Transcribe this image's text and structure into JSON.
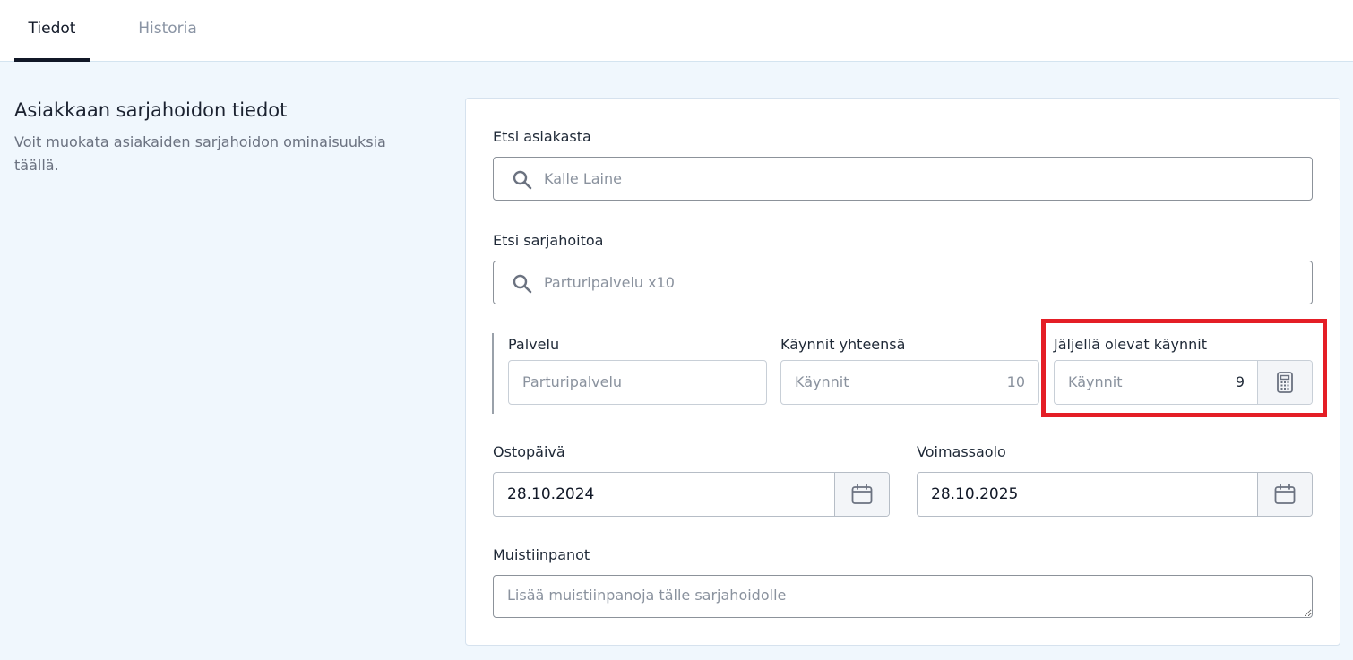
{
  "tabs": [
    {
      "label": "Tiedot",
      "active": true
    },
    {
      "label": "Historia",
      "active": false
    }
  ],
  "section": {
    "title": "Asiakkaan sarjahoidon tiedot",
    "description": "Voit muokata asiakaiden sarjahoidon ominaisuuksia täällä."
  },
  "form": {
    "customer_search": {
      "label": "Etsi asiakasta",
      "placeholder": "Kalle Laine"
    },
    "package_search": {
      "label": "Etsi sarjahoitoa",
      "placeholder": "Parturipalvelu x10"
    },
    "service": {
      "label": "Palvelu",
      "placeholder": "Parturipalvelu"
    },
    "total_visits": {
      "label": "Käynnit yhteensä",
      "placeholder": "Käynnit",
      "value": "10"
    },
    "remaining_visits": {
      "label": "Jäljellä olevat käynnit",
      "placeholder": "Käynnit",
      "value": "9"
    },
    "purchase_date": {
      "label": "Ostopäivä",
      "value": "28.10.2024"
    },
    "validity": {
      "label": "Voimassaolo",
      "value": "28.10.2025"
    },
    "notes": {
      "label": "Muistiinpanot",
      "placeholder": "Lisää muistiinpanoja tälle sarjahoidolle"
    }
  },
  "colors": {
    "highlight": "#e41e26",
    "page_background": "#f0f7fd",
    "active_tab": "#111827"
  },
  "icons": {
    "search": "search-icon",
    "calculator": "calculator-icon",
    "calendar": "calendar-icon"
  }
}
